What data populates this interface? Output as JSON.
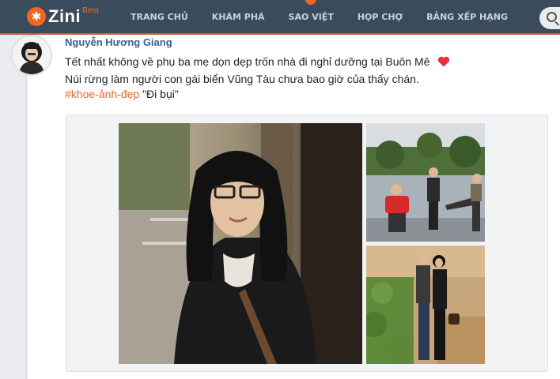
{
  "app": {
    "logo_text": "Zini",
    "logo_badge": "Beta",
    "brand_color": "#f26522",
    "nav_bg": "#3a4b5c"
  },
  "nav": {
    "items": [
      {
        "label": "TRANG CHỦ"
      },
      {
        "label": "KHÁM PHÁ"
      },
      {
        "label": "SAO VIỆT"
      },
      {
        "label": "HỌP CHỢ"
      },
      {
        "label": "BẢNG XẾP HẠNG"
      }
    ],
    "search_icon": "search-icon"
  },
  "post": {
    "author": "Nguyễn Hương Giang",
    "line1": "Tết nhất không về phụ ba mẹ dọn dẹp trốn nhà đi nghỉ dưỡng tại Buôn Mê",
    "line2": "Núi rừng làm người con gái biển Vũng Tàu chưa bao giờ của thấy chán.",
    "hashtag": "#khoe-ảnh-đẹp",
    "caption": "\"Đi bụi\"",
    "emoji": "heart-icon",
    "photos": [
      {
        "name": "photo-portrait"
      },
      {
        "name": "photo-group-by-river"
      },
      {
        "name": "photo-couple-in-field"
      }
    ]
  }
}
